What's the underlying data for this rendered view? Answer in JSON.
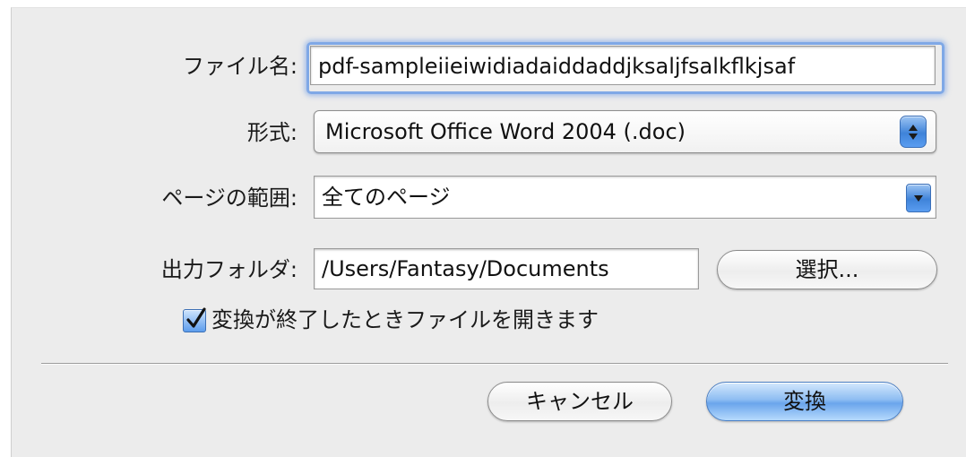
{
  "dialog": {
    "filename": {
      "label": "ファイル名:",
      "value": "pdf-sampleiieiwidiadaiddaddjksaljfsalkflkjsaf"
    },
    "format": {
      "label": "形式:",
      "selected": "Microsoft Office Word 2004 (.doc)"
    },
    "page_range": {
      "label": "ページの範囲:",
      "selected": "全てのページ"
    },
    "output_folder": {
      "label": "出力フォルダ:",
      "value": "/Users/Fantasy/Documents",
      "choose_label": "選択..."
    },
    "open_after": {
      "label": "変換が終了したときファイルを開きます",
      "checked": true
    },
    "buttons": {
      "cancel": "キャンセル",
      "convert": "変換"
    }
  },
  "colors": {
    "accent": "#5d9ded",
    "background": "#ececec"
  }
}
